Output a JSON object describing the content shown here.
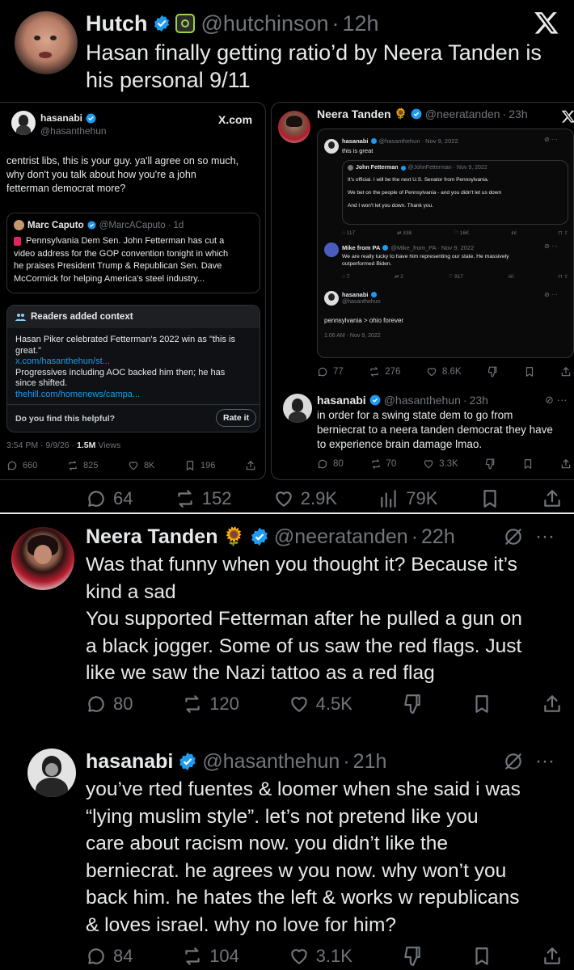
{
  "top_post": {
    "author_name": "Hutch",
    "author_handle": "@hutchinson",
    "sep": "·",
    "time": "12h",
    "text_line1": "Hasan finally getting ratio’d by Neera Tanden is",
    "text_line2": "his personal 9/11",
    "actions": {
      "replies": "64",
      "reposts": "152",
      "likes": "2.9K",
      "views": "79K"
    }
  },
  "left_embed": {
    "author_name": "hasanabi",
    "author_handle": "@hasanthehun",
    "brand": "X.com",
    "text_line1": "centrist libs, this is your guy. ya'll agree on so much,",
    "text_line2": "why don't you talk about how you're a john",
    "text_line3": "fetterman democrat more?",
    "quote": {
      "author_name": "Marc Caputo",
      "author_handle": "@MarcACaputo",
      "time": "1d",
      "line1": "Pennsylvania Dem Sen. John Fetterman has cut a",
      "line2": "video address for the GOP convention tonight in which",
      "line3": "he praises President Trump & Republican Sen. Dave",
      "line4": "McCormick for helping America's steel industry..."
    },
    "context": {
      "heading": "Readers added context",
      "line1": "Hasan Piker celebrated Fetterman's 2022 win as \"this is",
      "line2": "great.\"",
      "link1": "x.com/hasanthehun/st...",
      "line3": "Progressives including AOC backed him then; he has",
      "line4": "since shifted.",
      "link2": "thehill.com/homenews/campa...",
      "question": "Do you find this helpful?",
      "rate_button": "Rate it"
    },
    "meta_time": "3:54 PM · 9/9/26 ·",
    "meta_views_count": "1.5M",
    "meta_views_label": "Views",
    "actions": {
      "replies": "660",
      "reposts": "825",
      "likes": "8K",
      "bookmarks": "196"
    }
  },
  "right_embed": {
    "author_name": "Neera Tanden",
    "author_emoji": "🌻",
    "author_handle": "@neeratanden",
    "time": "23h",
    "inner": {
      "hasan_name": "hasanabi",
      "hasan_handle": "@hasanthehun · Nov 9, 2022",
      "hasan_text": "this is great",
      "fetterman_name": "John Fetterman",
      "fetterman_handle": "@JohnFetterman · Nov 9, 2022",
      "fetterman_line1": "It's official. I will be the next U.S. Senator from Pennsylvania.",
      "fetterman_line2": "We bet on the people of Pennsylvania - and you didn't let us down",
      "fetterman_line3": "And I won't let you down. Thank you.",
      "row1": {
        "replies": "117",
        "reposts": "338",
        "likes": "16K"
      },
      "mike_name": "Mike from PA",
      "mike_handle": "@Mike_from_PA · Nov 9, 2022",
      "mike_line1": "We are really lucky to have him representing our state. He massively",
      "mike_line2": "outperformed Biden.",
      "row2": {
        "replies": "7",
        "reposts": "2",
        "likes": "917"
      },
      "hasan2_name": "hasanabi",
      "hasan2_handle": "@hasanthehun",
      "hasan2_text": "pennsylvania > ohio forever",
      "hasan2_meta": "1:06 AM · Nov 9, 2022"
    },
    "actions": {
      "replies": "77",
      "reposts": "276",
      "likes": "8.6K"
    },
    "reply": {
      "author_name": "hasanabi",
      "author_handle": "@hasanthehun",
      "time": "23h",
      "line1": "in order for a swing state dem to go from",
      "line2": "berniecrat to a neera tanden democrat they have",
      "line3": "to experience brain damage lmao.",
      "actions": {
        "replies": "80",
        "reposts": "70",
        "likes": "3.3K"
      }
    }
  },
  "neera_reply": {
    "author_name": "Neera Tanden",
    "author_emoji": "🌻",
    "author_handle": "@neeratanden",
    "time": "22h",
    "line1": "Was that funny when you thought it? Because it’s",
    "line2": "kind a sad",
    "line3": "You supported Fetterman after he pulled a gun on",
    "line4": "a black jogger. Some of us saw the red flags. Just",
    "line5": "like we saw the Nazi tattoo as a red flag",
    "actions": {
      "replies": "80",
      "reposts": "120",
      "likes": "4.5K"
    }
  },
  "hasan_reply": {
    "author_name": "hasanabi",
    "author_handle": "@hasanthehun",
    "time": "21h",
    "line1": "you’ve rted fuentes & loomer when she said i was",
    "line2": "“lying muslim style”. let’s not pretend like you",
    "line3": "care about racism now. you didn’t like the",
    "line4": "berniecrat. he agrees w you now. why won’t you",
    "line5": "back him. he hates the left & works w republicans",
    "line6": "& loves israel. why no love for him?",
    "actions": {
      "replies": "84",
      "reposts": "104",
      "likes": "3.1K"
    }
  },
  "colors": {
    "verified": "#1d9bf0",
    "muted": "#71767b",
    "border": "#2f3336",
    "note_panel": "#16181c"
  }
}
